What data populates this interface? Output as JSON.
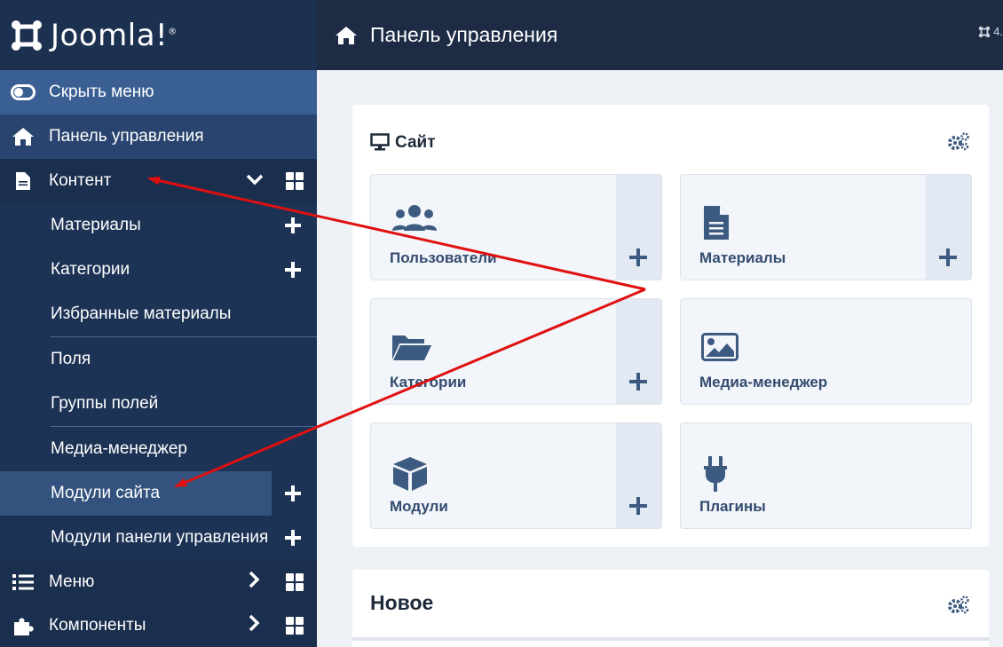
{
  "logo": {
    "text": "Joomla!",
    "mark": "®"
  },
  "topbar": {
    "title": "Панель управления",
    "version": "4."
  },
  "sidebar": {
    "toggle": "Скрыть меню",
    "dashboard": "Панель управления",
    "content": "Контент",
    "sub": [
      "Материалы",
      "Категории",
      "Избранные материалы",
      "Поля",
      "Группы полей",
      "Медиа-менеджер",
      "Модули сайта",
      "Модули панели управления"
    ],
    "menus": "Меню",
    "components": "Компоненты"
  },
  "site_card": {
    "title": "Сайт",
    "tiles": [
      {
        "label": "Пользователи",
        "icon": "users-icon"
      },
      {
        "label": "Материалы",
        "icon": "file-icon"
      },
      {
        "label": "Категории",
        "icon": "folder-icon"
      },
      {
        "label": "Медиа-менеджер",
        "icon": "image-icon"
      },
      {
        "label": "Модули",
        "icon": "cube-icon"
      },
      {
        "label": "Плагины",
        "icon": "plug-icon"
      }
    ]
  },
  "new_card": {
    "title": "Новое"
  },
  "colors": {
    "sidebar": "#1d3355",
    "topbar": "#1d2b45",
    "tile": "#f2f5fa",
    "icon": "#3d5a80",
    "arrow": "#e01010"
  }
}
